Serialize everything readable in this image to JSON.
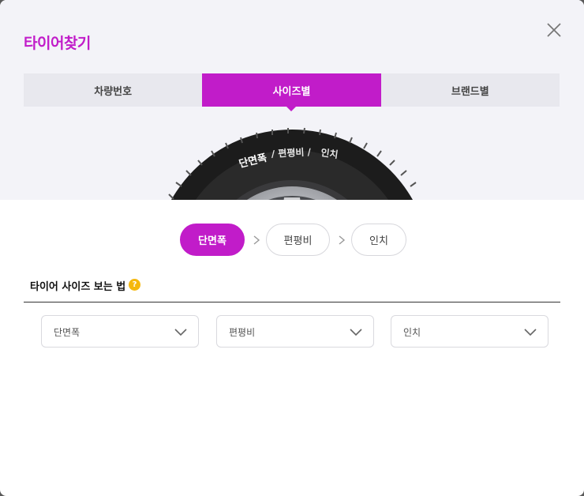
{
  "dialog": {
    "title": "타이어찾기",
    "close_icon": "close-icon"
  },
  "tabs": [
    {
      "label": "차량번호",
      "active": false
    },
    {
      "label": "사이즈별",
      "active": true
    },
    {
      "label": "브랜드별",
      "active": false
    }
  ],
  "tire_image": {
    "labels": [
      "단면폭",
      "/ 편평비 /",
      "인치"
    ]
  },
  "steps": [
    {
      "label": "단면폭",
      "active": true
    },
    {
      "label": "편평비",
      "active": false
    },
    {
      "label": "인치",
      "active": false
    }
  ],
  "guide": {
    "label": "타이어 사이즈 보는 법",
    "help_icon_glyph": "?"
  },
  "selects": [
    {
      "value": "단면폭"
    },
    {
      "value": "편평비"
    },
    {
      "value": "인치"
    }
  ],
  "colors": {
    "accent": "#c11cc9",
    "help": "#f5b80d"
  }
}
